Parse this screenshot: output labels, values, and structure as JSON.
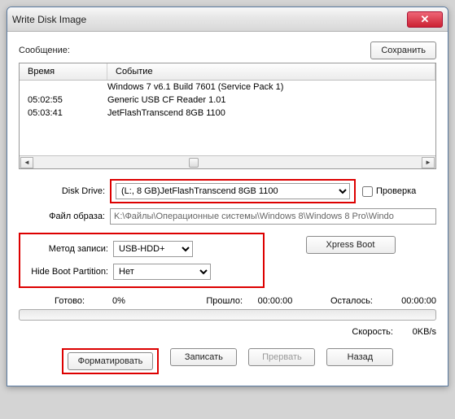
{
  "title": "Write Disk Image",
  "message_label": "Сообщение:",
  "save_btn": "Сохранить",
  "log": {
    "col_time": "Время",
    "col_event": "Событие",
    "rows": [
      {
        "time": "",
        "event": "Windows 7 v6.1 Build 7601 (Service Pack 1)"
      },
      {
        "time": "05:02:55",
        "event": "Generic USB CF Reader   1.01"
      },
      {
        "time": "05:03:41",
        "event": "JetFlashTranscend 8GB   1100"
      }
    ]
  },
  "disk_drive_label": "Disk Drive:",
  "disk_drive_value": "(L:, 8 GB)JetFlashTranscend 8GB   1100",
  "check_label": "Проверка",
  "image_label": "Файл образа:",
  "image_value": "K:\\Файлы\\Операционные системы\\Windows 8\\Windows 8 Pro\\Windo",
  "write_method_label": "Метод записи:",
  "write_method_value": "USB-HDD+",
  "hide_label": "Hide Boot Partition:",
  "hide_value": "Нет",
  "xpress_btn": "Xpress Boot",
  "status": {
    "ready": "Готово:",
    "ready_val": "0%",
    "elapsed": "Прошло:",
    "elapsed_val": "00:00:00",
    "remain": "Осталось:",
    "remain_val": "00:00:00"
  },
  "speed_label": "Скорость:",
  "speed_val": "0KB/s",
  "buttons": {
    "format": "Форматировать",
    "write": "Записать",
    "abort": "Прервать",
    "back": "Назад"
  }
}
